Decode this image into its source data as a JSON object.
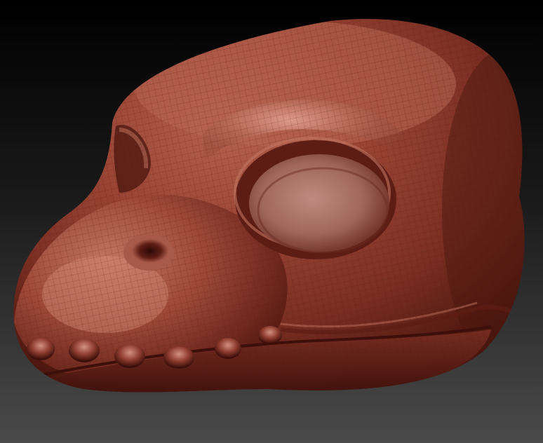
{
  "scene": {
    "subject_icon": "sculpted-reptile-head-icon",
    "colors": {
      "background_top": "#000000",
      "background_bottom": "#4a4a4a",
      "clay_base": "#8c3a2c",
      "clay_light": "#c27462",
      "clay_highlight": "#e8a898",
      "clay_shadow": "#4a160e",
      "clay_deep": "#2c0906",
      "wire_color": "#5a2018"
    }
  }
}
